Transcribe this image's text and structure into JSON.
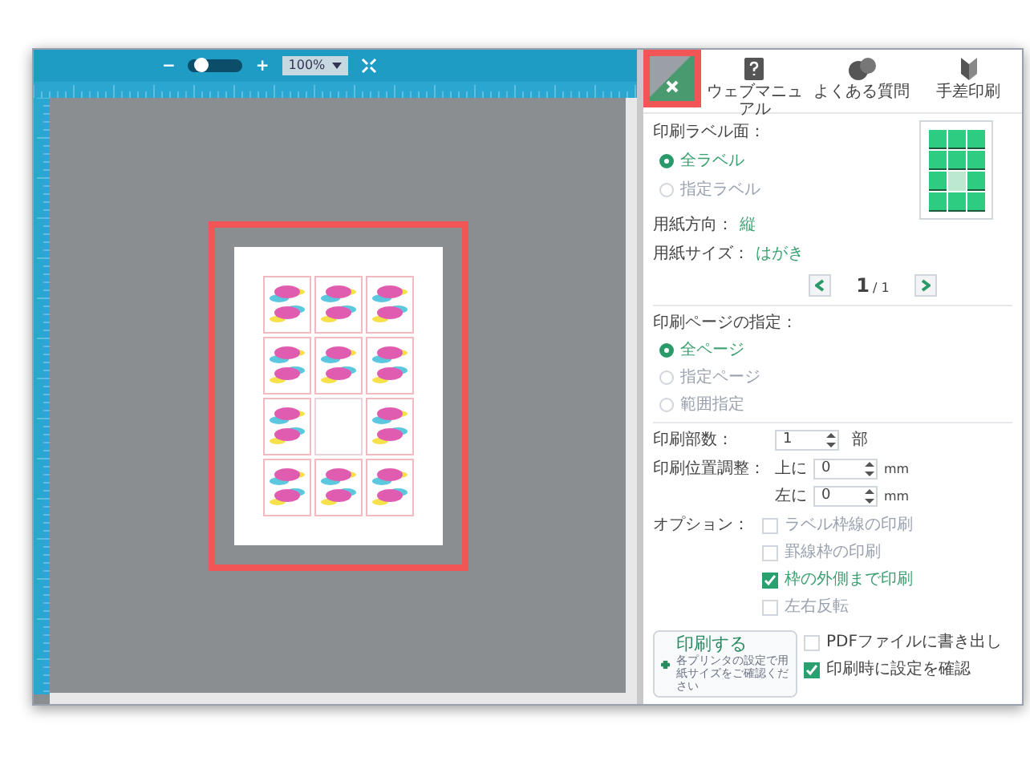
{
  "toolbar": {
    "zoom_minus": "−",
    "zoom_plus": "+",
    "zoom": {
      "level": 0.15
    },
    "zoom_value": "100%"
  },
  "sheet": {
    "labels": [
      {
        "filled": true
      },
      {
        "filled": true
      },
      {
        "filled": true
      },
      {
        "filled": true
      },
      {
        "filled": true
      },
      {
        "filled": true
      },
      {
        "filled": true
      },
      {
        "filled": false
      },
      {
        "filled": true
      },
      {
        "filled": true
      },
      {
        "filled": true
      },
      {
        "filled": true
      }
    ]
  },
  "tabs": [
    {
      "kind": "close",
      "selected": true
    },
    {
      "kind": "manual",
      "label": "ウェブマニュアル",
      "selected": false
    },
    {
      "kind": "faq",
      "label": "よくある質問",
      "selected": false
    },
    {
      "kind": "guide",
      "label": "手差印刷",
      "selected": false
    }
  ],
  "label_side": {
    "title": "印刷ラベル面：",
    "options": [
      {
        "label": "全ラベル",
        "selected": true
      },
      {
        "label": "指定ラベル",
        "selected": false
      }
    ]
  },
  "orientation": {
    "label": "用紙方向：",
    "value": "縦"
  },
  "paper_size": {
    "label": "用紙サイズ：",
    "value": "はがき"
  },
  "pager": {
    "current": "1",
    "total": "/ 1"
  },
  "page_range": {
    "title": "印刷ページの指定：",
    "options": [
      {
        "label": "全ページ",
        "selected": true
      },
      {
        "label": "指定ページ",
        "selected": false
      },
      {
        "label": "範囲指定",
        "selected": false
      }
    ]
  },
  "copies": {
    "label": "印刷部数：",
    "value": "1",
    "unit": "部"
  },
  "position": {
    "label": "印刷位置調整：",
    "rows": [
      {
        "label": "上に",
        "value": "0",
        "unit": "mm"
      },
      {
        "label": "左に",
        "value": "0",
        "unit": "mm"
      }
    ]
  },
  "options": {
    "label": "オプション：",
    "items": [
      {
        "label": "ラベル枠線の印刷",
        "checked": false
      },
      {
        "label": "罫線枠の印刷",
        "checked": false
      },
      {
        "label": "枠の外側まで印刷",
        "checked": true
      },
      {
        "label": "左右反転",
        "checked": false
      }
    ]
  },
  "print_button": {
    "label": "印刷する",
    "note": "各プリンタの設定で用紙サイズをご確認ください"
  },
  "print_checks": [
    {
      "label": "PDFファイルに書き出し",
      "checked": false
    },
    {
      "label": "印刷時に設定を確認",
      "checked": true
    }
  ]
}
